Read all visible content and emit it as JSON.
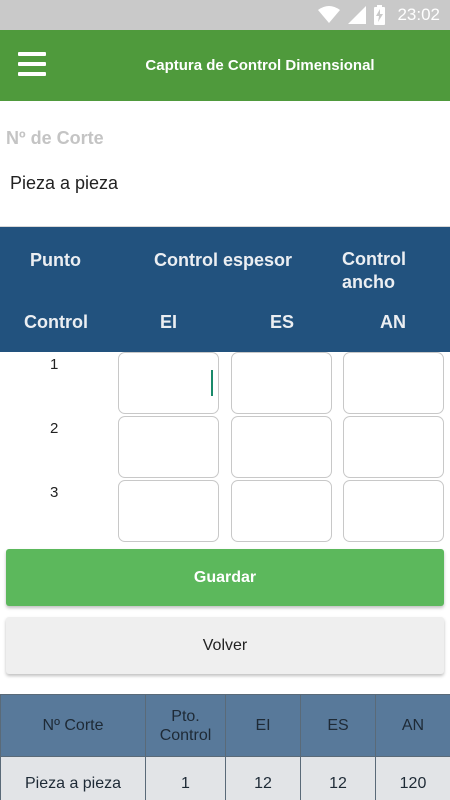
{
  "status_bar": {
    "time": "23:02",
    "icons": [
      "wifi-icon",
      "signal-icon",
      "battery-charging-icon"
    ]
  },
  "app_bar": {
    "title": "Captura de Control Dimensional",
    "menu_icon": "hamburger-menu-icon"
  },
  "corte": {
    "label": "Nº de Corte",
    "value": "Pieza a pieza"
  },
  "header": {
    "punto": "Punto",
    "control_espesor": "Control espesor",
    "control_ancho_line1": "Control",
    "control_ancho_line2": "ancho",
    "control": "Control",
    "ei": "EI",
    "es": "ES",
    "an": "AN"
  },
  "grid": {
    "rows": [
      {
        "num": "1",
        "ei": "",
        "es": "",
        "an": ""
      },
      {
        "num": "2",
        "ei": "",
        "es": "",
        "an": ""
      },
      {
        "num": "3",
        "ei": "",
        "es": "",
        "an": ""
      }
    ]
  },
  "buttons": {
    "guardar": "Guardar",
    "volver": "Volver"
  },
  "table": {
    "headers": [
      "Nº Corte",
      "Pto. Control",
      "EI",
      "ES",
      "AN"
    ],
    "header_pto_line1": "Pto.",
    "header_pto_line2": "Control",
    "rows": [
      [
        "Pieza a pieza",
        "1",
        "12",
        "12",
        "120"
      ]
    ]
  },
  "colors": {
    "app_bar": "#4f9a3c",
    "header_blue": "#22527e",
    "guardar_green": "#5cb85c",
    "table_header": "#58799a"
  }
}
